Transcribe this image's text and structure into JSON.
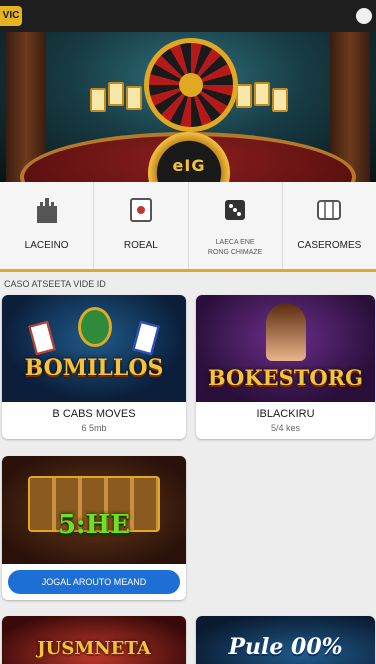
{
  "topbar": {
    "logo": "VIC"
  },
  "hero": {
    "badge_text": "eIG"
  },
  "categories": [
    {
      "label": "LACEINO",
      "icon": "castle-icon"
    },
    {
      "label": "ROEAL",
      "icon": "slot-card-icon"
    },
    {
      "label": "LAECA ENE\nRONG CHIMAZE",
      "icon": "dice-icon"
    },
    {
      "label": "CASEROMES",
      "icon": "slot-reels-icon"
    }
  ],
  "section_title": "CASO ATSEETA VIDE ID",
  "games": [
    {
      "art_title": "BOMILLOS",
      "name": "B CABS MOVES",
      "sub": "6 5mb"
    },
    {
      "art_title": "BOKESTORG",
      "name": "IBLACKIRU",
      "sub": "5/4 kes"
    },
    {
      "art_title": "5:HE",
      "button": "JOGAL AROUTO MEAND"
    },
    {
      "art_title": "JUSMNETA"
    },
    {
      "art_title": "Pule 00%"
    }
  ],
  "colors": {
    "accent": "#e0a823",
    "button": "#1d6fd6"
  }
}
